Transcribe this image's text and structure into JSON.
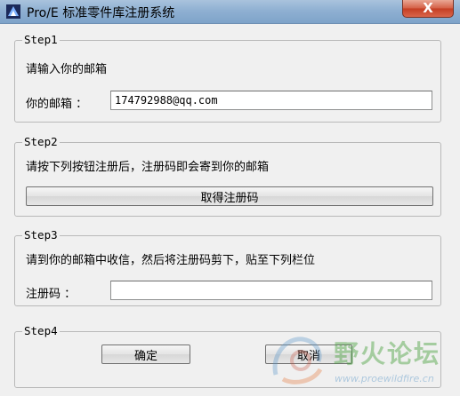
{
  "window": {
    "title": "Pro/E 标准零件库注册系统",
    "close_label": "X"
  },
  "step1": {
    "legend": "Step1",
    "instruction": "请输入你的邮箱",
    "email_label": "你的邮箱 ：",
    "email_value": "174792988@qq.com"
  },
  "step2": {
    "legend": "Step2",
    "instruction": "请按下列按钮注册后，注册码即会寄到你的邮箱",
    "get_code_label": "取得注册码"
  },
  "step3": {
    "legend": "Step3",
    "instruction": "请到你的邮箱中收信，然后将注册码剪下，贴至下列栏位",
    "code_label": "注册码 ：",
    "code_value": ""
  },
  "step4": {
    "legend": "Step4",
    "confirm_label": "确定",
    "cancel_label": "取消"
  },
  "watermark": {
    "text": "野火论坛",
    "url": "www.proewildfire.cn"
  },
  "colors": {
    "titlebar": "#8fb0d2",
    "close_button": "#c43d22",
    "window_bg": "#f0f0f0",
    "watermark_green": "#46a03c"
  }
}
